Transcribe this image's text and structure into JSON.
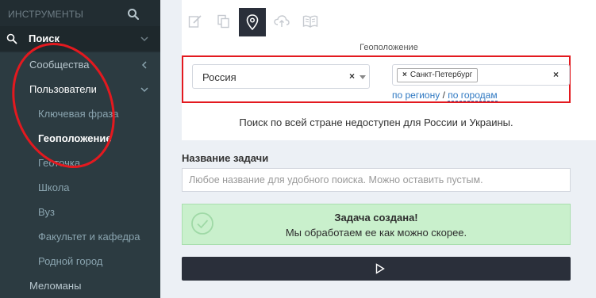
{
  "sidebar": {
    "title": "ИНСТРУМЕНТЫ",
    "search_item": "Поиск",
    "communities": "Сообщества",
    "users": "Пользователи",
    "sub_items": [
      {
        "label": "Ключевая фраза"
      },
      {
        "label": "Геоположение"
      },
      {
        "label": "Геоточка"
      },
      {
        "label": "Школа"
      },
      {
        "label": "Вуз"
      },
      {
        "label": "Факультет и кафедра"
      },
      {
        "label": "Родной город"
      }
    ],
    "music_lovers": "Меломаны"
  },
  "tabs": [
    {
      "icon": "edit-icon"
    },
    {
      "icon": "copy-icon"
    },
    {
      "icon": "map-pin-icon",
      "active": true
    },
    {
      "icon": "cloud-upload-icon"
    },
    {
      "icon": "book-icon"
    }
  ],
  "geo": {
    "section_label": "Геоположение",
    "country_value": "Россия",
    "city_tag": "Санкт-Петербург",
    "link_region": "по региону",
    "link_separator": "/",
    "link_cities": "по городам",
    "notice": "Поиск по всей стране недоступен для России и Украины."
  },
  "task": {
    "label": "Название задачи",
    "placeholder": "Любое название для удобного поиска. Можно оставить пустым."
  },
  "alert": {
    "title": "Задача создана!",
    "message": "Мы обработаем ее как можно скорее."
  },
  "colors": {
    "sidebar_bg": "#222d32",
    "sidebar_sub_bg": "#2c3b41",
    "accent_dark": "#2a2f3a",
    "highlight_red": "#e3191f",
    "success_bg": "#c9f0cc",
    "link": "#2e78c2"
  }
}
